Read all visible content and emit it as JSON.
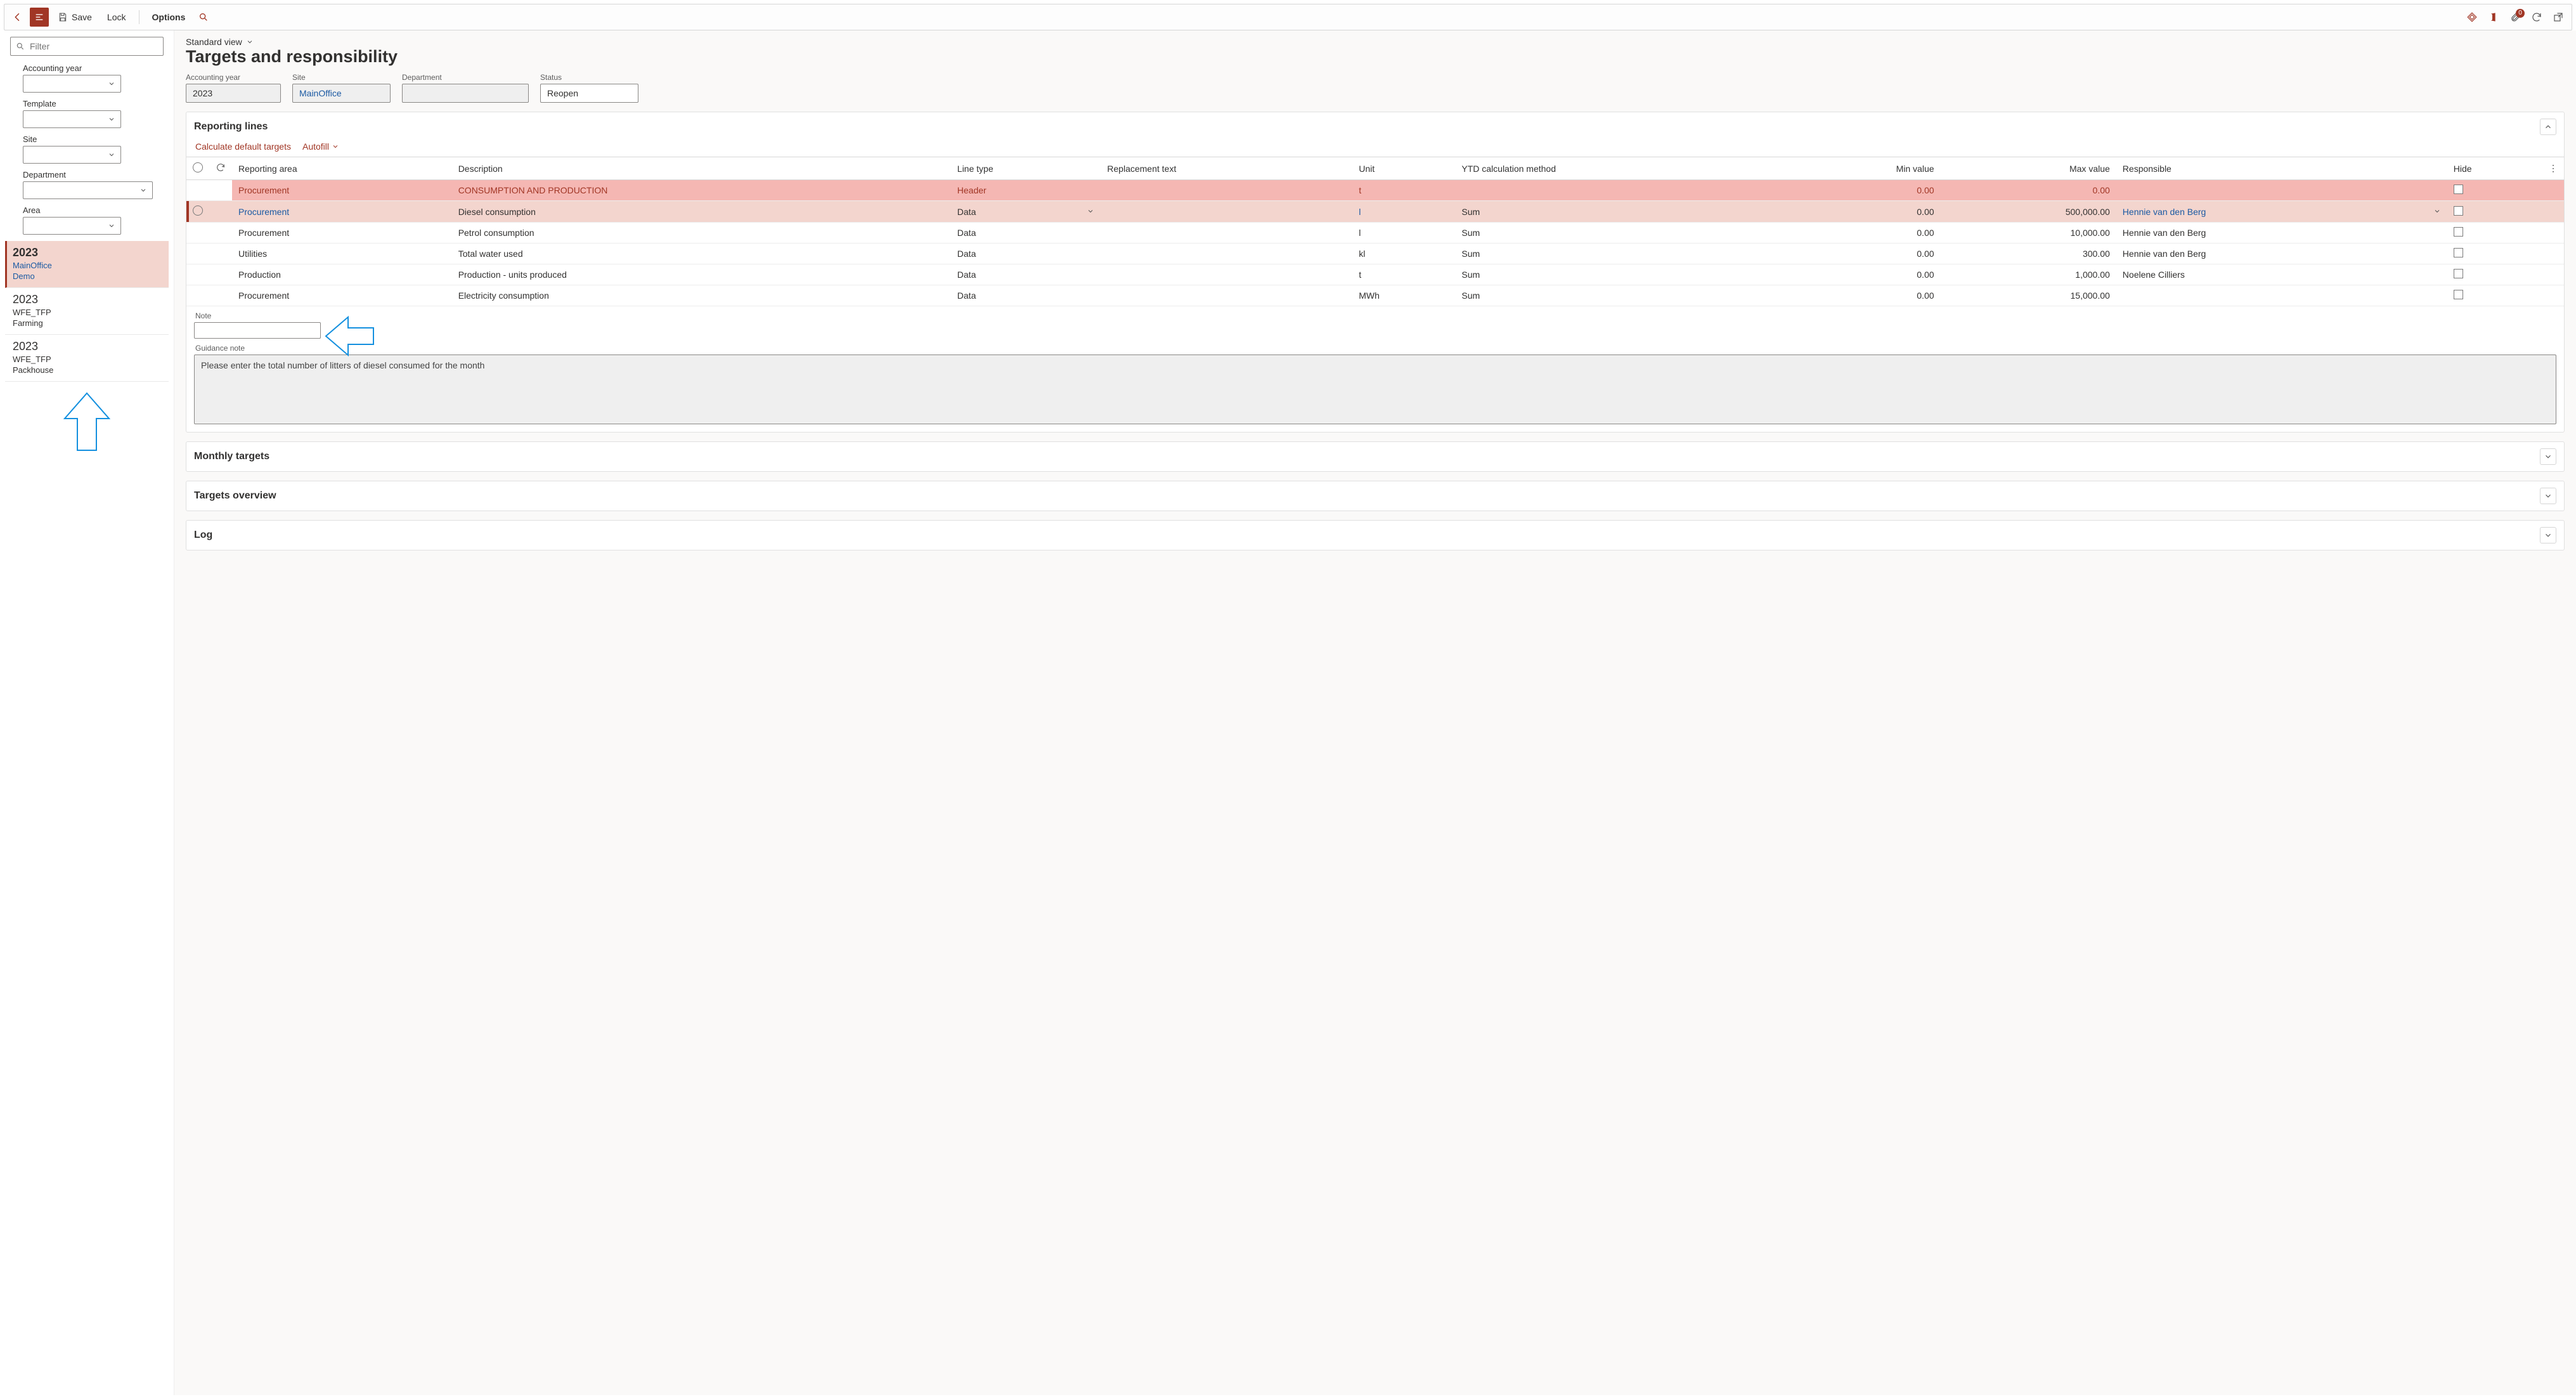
{
  "topbar": {
    "save": "Save",
    "lock": "Lock",
    "options": "Options",
    "badge_count": "0"
  },
  "side": {
    "filter_placeholder": "Filter",
    "labels": {
      "accounting_year": "Accounting year",
      "template": "Template",
      "site": "Site",
      "department": "Department",
      "area": "Area"
    },
    "list": [
      {
        "year": "2023",
        "line1": "MainOffice",
        "line2": "Demo",
        "selected": true
      },
      {
        "year": "2023",
        "line1": "WFE_TFP",
        "line2": "Farming",
        "selected": false
      },
      {
        "year": "2023",
        "line1": "WFE_TFP",
        "line2": "Packhouse",
        "selected": false
      }
    ]
  },
  "header": {
    "view": "Standard view",
    "title": "Targets and responsibility",
    "fields": {
      "accounting_year": {
        "label": "Accounting year",
        "value": "2023"
      },
      "site": {
        "label": "Site",
        "value": "MainOffice"
      },
      "department": {
        "label": "Department",
        "value": ""
      },
      "status": {
        "label": "Status",
        "value": "Reopen"
      }
    }
  },
  "reporting": {
    "title": "Reporting lines",
    "cmd_calc": "Calculate default targets",
    "cmd_autofill": "Autofill",
    "columns": {
      "reporting_area": "Reporting area",
      "description": "Description",
      "line_type": "Line type",
      "replacement_text": "Replacement text",
      "unit": "Unit",
      "ytd": "YTD calculation method",
      "min": "Min value",
      "max": "Max value",
      "responsible": "Responsible",
      "hide": "Hide"
    },
    "rows": [
      {
        "kind": "header",
        "area": "Procurement",
        "desc": "CONSUMPTION AND PRODUCTION",
        "type": "Header",
        "repl": "",
        "unit": "t",
        "ytd": "",
        "min": "0.00",
        "max": "0.00",
        "resp": "",
        "hide": false
      },
      {
        "kind": "selected",
        "area": "Procurement",
        "desc": "Diesel consumption",
        "type": "Data",
        "repl": "",
        "unit": "l",
        "ytd": "Sum",
        "min": "0.00",
        "max": "500,000.00",
        "resp": "Hennie van den Berg",
        "hide": false
      },
      {
        "kind": "data",
        "area": "Procurement",
        "desc": "Petrol consumption",
        "type": "Data",
        "repl": "",
        "unit": "l",
        "ytd": "Sum",
        "min": "0.00",
        "max": "10,000.00",
        "resp": "Hennie van den Berg",
        "hide": false
      },
      {
        "kind": "data",
        "area": "Utilities",
        "desc": "Total water used",
        "type": "Data",
        "repl": "",
        "unit": "kl",
        "ytd": "Sum",
        "min": "0.00",
        "max": "300.00",
        "resp": "Hennie van den Berg",
        "hide": false
      },
      {
        "kind": "data",
        "area": "Production",
        "desc": "Production - units produced",
        "type": "Data",
        "repl": "",
        "unit": "t",
        "ytd": "Sum",
        "min": "0.00",
        "max": "1,000.00",
        "resp": "Noelene Cilliers",
        "hide": false
      },
      {
        "kind": "data",
        "area": "Procurement",
        "desc": "Electricity consumption",
        "type": "Data",
        "repl": "",
        "unit": "MWh",
        "ytd": "Sum",
        "min": "0.00",
        "max": "15,000.00",
        "resp": "",
        "hide": false
      }
    ],
    "note_label": "Note",
    "note_value": "",
    "guidance_label": "Guidance note",
    "guidance_value": "Please enter the total number of litters of diesel consumed for the month"
  },
  "sections": {
    "monthly": "Monthly targets",
    "overview": "Targets overview",
    "log": "Log"
  }
}
